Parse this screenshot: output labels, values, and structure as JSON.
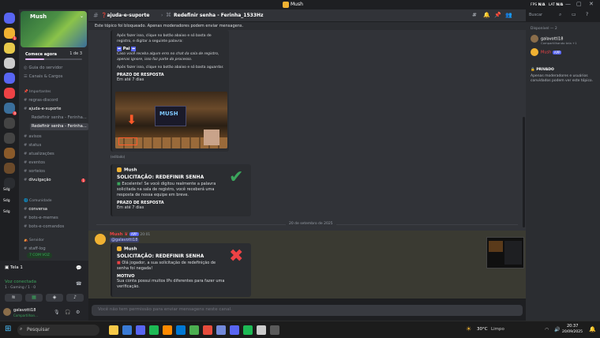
{
  "window": {
    "title": "Mush",
    "minimize": "—",
    "maximize": "▢",
    "close": "✕"
  },
  "server": {
    "name": "Mush",
    "boost_label": "Comece agora",
    "boost_count": "1 de 3",
    "boost_progress": 0.33
  },
  "servers": [
    {
      "icon": "discord-home-icon",
      "badge": "",
      "color": "#5865f2"
    },
    {
      "icon": "server-icon",
      "badge": "1",
      "color": "#f0b232"
    },
    {
      "icon": "server-icon",
      "badge": "",
      "color": "#e7c94a"
    },
    {
      "icon": "server-icon",
      "badge": "",
      "color": "#cccccc"
    },
    {
      "icon": "server-icon",
      "badge": "",
      "color": "#5865f2"
    },
    {
      "icon": "server-icon",
      "badge": "",
      "color": "#ed4245"
    },
    {
      "icon": "server-icon",
      "badge": "4",
      "color": "#3a6e9a"
    },
    {
      "icon": "server-icon",
      "badge": "",
      "color": "#444444"
    },
    {
      "icon": "server-icon",
      "badge": "",
      "color": "#444444"
    },
    {
      "icon": "server-icon",
      "badge": "",
      "color": "#8a5a2a"
    },
    {
      "icon": "server-icon",
      "badge": "",
      "color": "#6b4a2a"
    },
    {
      "icon": "server-icon",
      "badge": "",
      "color": "#2b2d31"
    }
  ],
  "server_labels": [
    "Sdg",
    "Sdg",
    "Sdg"
  ],
  "channels": {
    "guide": "Guia do servidor",
    "channels_roles": "Canais & Cargos",
    "cat_important": "Importantes",
    "rules": "regras-discord",
    "support": "ajuda-e-suporte",
    "thread1": "Redefinir senha - Ferinha...",
    "thread2": "Redefinir senha - Ferinha...",
    "notices": "avisos",
    "status": "status",
    "updates": "atualizações",
    "events": "eventos",
    "raffles": "sorteios",
    "promo": "divulgação",
    "promo_badge": "1",
    "cat_community": "Comunidade",
    "chat": "conversa",
    "bots_memes": "bots-e-memes",
    "bots_cmds": "bots-e-comandos",
    "cat_server": "Servidor",
    "staff": "staff-log",
    "voice_pill": "7 COM VOZ"
  },
  "voice": {
    "room": "Tela 1",
    "status": "Voz conectada",
    "sub": "1 · Gaming / 1 · 0"
  },
  "user": {
    "name": "galavotti18",
    "status": "Compartilhan..."
  },
  "header": {
    "thread_parent": "ajuda-e-suporte",
    "thread_title": "Redefinir senha - Ferinha_1533Hz",
    "search_placeholder": "Buscar"
  },
  "locked_notice": "Este tópico foi bloqueado. Apenas moderadores podem enviar mensagens.",
  "embed1": {
    "top_text": "Após fazer isso, clique no botão abaixo e só basta de registro, e digitar a seguinte palavra:",
    "word": "Pai",
    "hint": "Caso você receba algum erro no chat da sala de registro, apenas ignore, isso faz parte do processo.",
    "after": "Após fazer isso, clique no botão abaixo e só basta aguardar.",
    "deadline_label": "PRAZO DE RESPOSTA",
    "deadline": "Em até 7 dias",
    "img_text": "MUSH"
  },
  "edited": "(editado)",
  "embed2": {
    "author": "Mush",
    "title": "SOLICITAÇÃO: REDEFINIR SENHA",
    "desc": "Excelente! Se você digitou realmente a palavra solicitada na sala de registro, você receberá uma resposta de nossa equipe em breve.",
    "deadline_label": "PRAZO DE RESPOSTA",
    "deadline": "Em até 7 dias"
  },
  "date_divider": "20 de setembro de 2025",
  "message": {
    "author": "Mush",
    "tag": "APP",
    "time": "20:01",
    "mention": "@galavotti18"
  },
  "embed3": {
    "author": "Mush",
    "title": "SOLICITAÇÃO: REDEFINIR SENHA",
    "desc": "Olá jogador, a sua solicitação de redefinição de senha foi negada!",
    "reason_label": "MOTIVO",
    "reason": "Sua conta possui muitos IPs diferentes para fazer uma verificação."
  },
  "input_placeholder": "Você não tem permissão para enviar mensagens neste canal.",
  "members": {
    "header": "Disponível — 2",
    "m1_name": "galavotti18",
    "m1_status": "Compartilhando tela +1",
    "m2_name": "Mush",
    "m2_tag": "APP",
    "private_label": "PRIVADO",
    "private_text": "Apenas moderadores e usuários convidados podem ver este tópico."
  },
  "hud": {
    "fps_label": "FPS",
    "fps": "N/A",
    "lat_label": "LAT",
    "lat": "N/A"
  },
  "taskbar": {
    "search": "Pesquisar",
    "weather": "30°C",
    "weather_desc": "Limpo",
    "time": "20:37",
    "date": "20/09/2025"
  }
}
